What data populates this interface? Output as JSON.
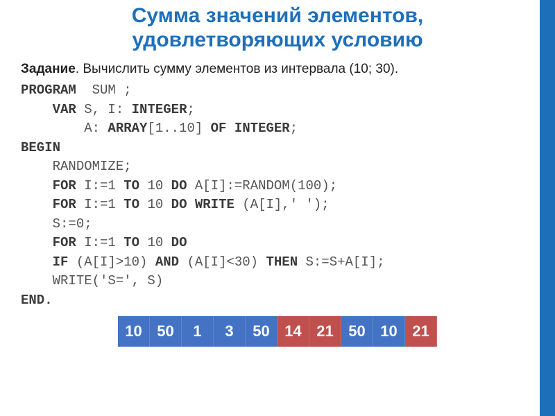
{
  "title": {
    "line1": "Сумма значений элементов,",
    "line2": "удовлетворяющих условию"
  },
  "task": {
    "label": "Задание",
    "text": ". Вычислить сумму элементов из интервала (10; 30)."
  },
  "code": {
    "l1a": "program",
    "l1b": "  sum ;",
    "l2a": "    var",
    "l2b": " s, i: ",
    "l2c": "integer",
    "l2d": ";",
    "l3a": "        a: ",
    "l3b": "array",
    "l3c": "[1..10] ",
    "l3d": "of integer",
    "l3e": ";",
    "l4": "begin",
    "l5": "    randomize;",
    "l6a": "    for",
    "l6b": " i:=1 ",
    "l6c": "to",
    "l6d": " 10 ",
    "l6e": "do",
    "l6f": " a[i]:=random(100);",
    "l7a": "    for",
    "l7b": " i:=1 ",
    "l7c": "to",
    "l7d": " 10 ",
    "l7e": "do write",
    "l7f": " (a[i],' ');",
    "l8": "    s:=0;",
    "l9a": "    for",
    "l9b": " i:=1 ",
    "l9c": "to",
    "l9d": " 10 ",
    "l9e": "do",
    "l10a": "    if",
    "l10b": " (a[i]>10) ",
    "l10c": "and",
    "l10d": " (a[i]<30) ",
    "l10e": "then",
    "l10f": " s:=s+a[i];",
    "l11": "    write('s=', s)",
    "l12": "end."
  },
  "colors": {
    "blue": "#4472C4",
    "red": "#C0504D"
  },
  "array": [
    {
      "v": "10",
      "c": "blue"
    },
    {
      "v": "50",
      "c": "blue"
    },
    {
      "v": "1",
      "c": "blue"
    },
    {
      "v": "3",
      "c": "blue"
    },
    {
      "v": "50",
      "c": "blue"
    },
    {
      "v": "14",
      "c": "red"
    },
    {
      "v": "21",
      "c": "red"
    },
    {
      "v": "50",
      "c": "blue"
    },
    {
      "v": "10",
      "c": "blue"
    },
    {
      "v": "21",
      "c": "red"
    }
  ]
}
